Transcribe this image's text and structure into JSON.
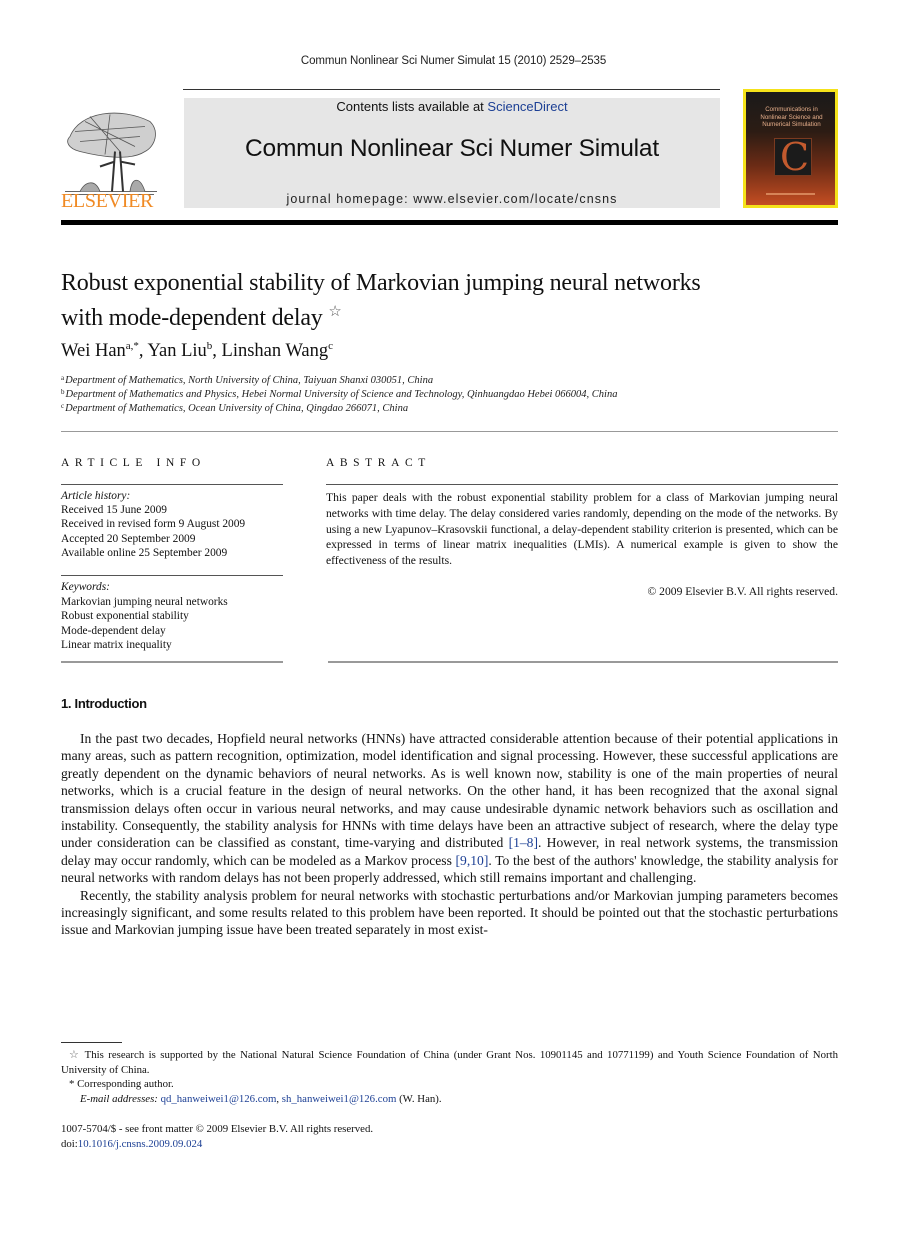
{
  "journal": {
    "citation": "Commun Nonlinear Sci Numer Simulat 15 (2010) 2529–2535",
    "contents_prefix": "Contents lists available at ",
    "contents_link": "ScienceDirect",
    "title": "Commun Nonlinear Sci Numer Simulat",
    "homepage": "journal homepage: www.elsevier.com/locate/cnsns",
    "publisher_logo_text": "ELSEVIER",
    "cover_text": "Communications in Nonlinear Science and Numerical Simulation",
    "cover_glyph": "C",
    "publisher_color": "#f08a24",
    "link_color": "#1c3f94"
  },
  "article": {
    "title_line1": "Robust exponential stability of Markovian jumping neural networks",
    "title_line2": "with mode-dependent delay",
    "title_note_mark": "☆",
    "authors": [
      {
        "name": "Wei Han",
        "sup": "a,*"
      },
      {
        "name": "Yan Liu",
        "sup": "b"
      },
      {
        "name": "Linshan Wang",
        "sup": "c"
      }
    ],
    "affiliations": [
      {
        "mark": "a",
        "text": "Department of Mathematics, North University of China, Taiyuan Shanxi 030051, China"
      },
      {
        "mark": "b",
        "text": "Department of Mathematics and Physics, Hebei Normal University of Science and Technology, Qinhuangdao Hebei 066004, China"
      },
      {
        "mark": "c",
        "text": "Department of Mathematics, Ocean University of China, Qingdao 266071, China"
      }
    ]
  },
  "article_info": {
    "heading": "ARTICLE INFO",
    "history_label": "Article history:",
    "history": [
      "Received 15 June 2009",
      "Received in revised form 9 August 2009",
      "Accepted 20 September 2009",
      "Available online 25 September 2009"
    ],
    "keywords_label": "Keywords:",
    "keywords": [
      "Markovian jumping neural networks",
      "Robust exponential stability",
      "Mode-dependent delay",
      "Linear matrix inequality"
    ]
  },
  "abstract": {
    "heading": "ABSTRACT",
    "text": "This paper deals with the robust exponential stability problem for a class of Markovian jumping neural networks with time delay. The delay considered varies randomly, depending on the mode of the networks. By using a new Lyapunov–Krasovskii functional, a delay-dependent stability criterion is presented, which can be expressed in terms of linear matrix inequalities (LMIs). A numerical example is given to show the effectiveness of the results.",
    "copyright": "© 2009 Elsevier B.V. All rights reserved."
  },
  "introduction": {
    "heading": "1.  Introduction",
    "p1_a": "In the past two decades, Hopfield neural networks (HNNs) have attracted considerable attention because of their potential applications in many areas, such as pattern recognition, optimization, model identification and signal processing. However, these successful applications are greatly dependent on the dynamic behaviors of neural networks. As is well known now, stability is one of the main properties of neural networks, which is a crucial feature in the design of neural networks. On the other hand, it has been recognized that the axonal signal transmission delays often occur in various neural networks, and may cause undesirable dynamic network behaviors such as oscillation and instability. Consequently, the stability analysis for HNNs with time delays have been an attractive subject of research, where the delay type under consideration can be classified as constant, time-varying and distributed ",
    "p1_ref1": "[1–8]",
    "p1_b": ". However, in real network systems, the transmission delay may occur randomly, which can be modeled as a Markov process ",
    "p1_ref2": "[9,10]",
    "p1_c": ". To the best of the authors' knowledge, the stability analysis for neural networks with random delays has not been properly addressed, which still remains important and challenging.",
    "p2": "Recently, the stability analysis problem for neural networks with stochastic perturbations and/or Markovian jumping parameters becomes increasingly significant, and some results related to this problem have been reported. It should be pointed out that the stochastic perturbations issue and Markovian jumping issue have been treated separately in most exist-"
  },
  "footnotes": {
    "funding_mark": "☆",
    "funding": "This research is supported by the National Natural Science Foundation of China (under Grant Nos. 10901145 and 10771199) and Youth Science Foundation of North University of China.",
    "corresponding_mark": "*",
    "corresponding": "Corresponding author.",
    "email_label": "E-mail addresses:",
    "email1": "qd_hanweiwei1@126.com",
    "email_sep": ", ",
    "email2": "sh_hanweiwei1@126.com",
    "email_suffix": " (W. Han).",
    "front_matter": "1007-5704/$ - see front matter © 2009 Elsevier B.V. All rights reserved.",
    "doi_label": "doi:",
    "doi": "10.1016/j.cnsns.2009.09.024"
  }
}
